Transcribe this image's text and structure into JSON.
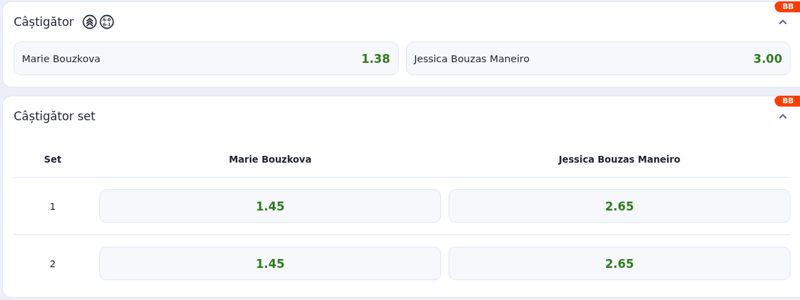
{
  "markets": [
    {
      "kind": "simple",
      "title": "Câștigător",
      "badge": "BB",
      "expanded": true,
      "score_icon_lines": [
        "6-0",
        "6-1"
      ],
      "options": [
        {
          "name": "Marie Bouzkova",
          "odds": "1.38"
        },
        {
          "name": "Jessica Bouzas Maneiro",
          "odds": "3.00"
        }
      ]
    },
    {
      "kind": "table",
      "title": "Câștigător set",
      "badge": "BB",
      "expanded": true,
      "columns": [
        "Set",
        "Marie Bouzkova",
        "Jessica Bouzas Maneiro"
      ],
      "rows": [
        {
          "set": "1",
          "odds": [
            "1.45",
            "2.65"
          ]
        },
        {
          "set": "2",
          "odds": [
            "1.45",
            "2.65"
          ]
        }
      ]
    }
  ]
}
